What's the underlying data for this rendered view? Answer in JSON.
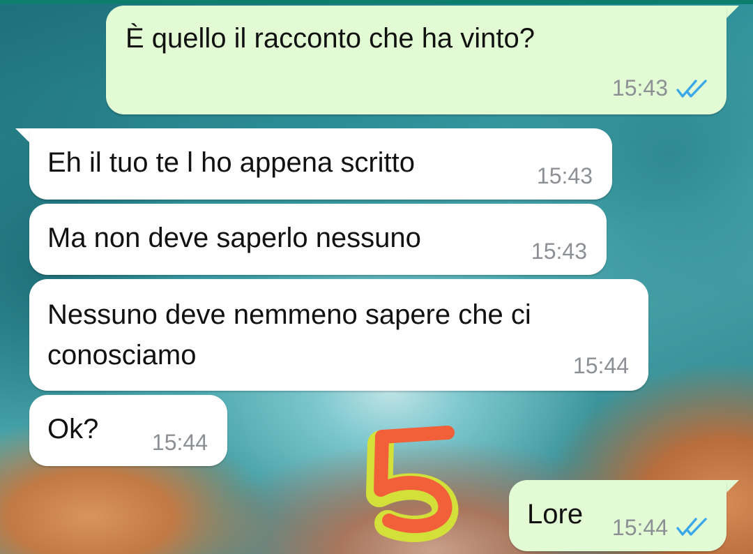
{
  "messages": [
    {
      "direction": "out",
      "text": "È quello il racconto che ha vinto?",
      "time": "15:43",
      "status_icon": "double-check-read-icon"
    },
    {
      "direction": "in",
      "text": "Eh il tuo te l ho appena scritto",
      "time": "15:43"
    },
    {
      "direction": "in",
      "text": "Ma non deve saperlo nessuno",
      "time": "15:43"
    },
    {
      "direction": "in",
      "text_line1": "Nessuno deve nemmeno sapere che ci",
      "text_line2": "conosciamo",
      "time": "15:44"
    },
    {
      "direction": "in",
      "text": "Ok?",
      "time": "15:44"
    },
    {
      "direction": "out",
      "text": "Lore",
      "time": "15:44",
      "status_icon": "double-check-read-icon"
    }
  ],
  "colors": {
    "outgoing_bubble": "#e2fbd4",
    "incoming_bubble": "#ffffff",
    "read_ticks": "#3aa8e8",
    "timestamp": "#8c9095",
    "header_strip": "#0d7e6b",
    "sticker_stroke": "#f2603a",
    "sticker_fill": "#d4e03a"
  },
  "sticker": {
    "icon": "number-five-sticker-icon"
  }
}
